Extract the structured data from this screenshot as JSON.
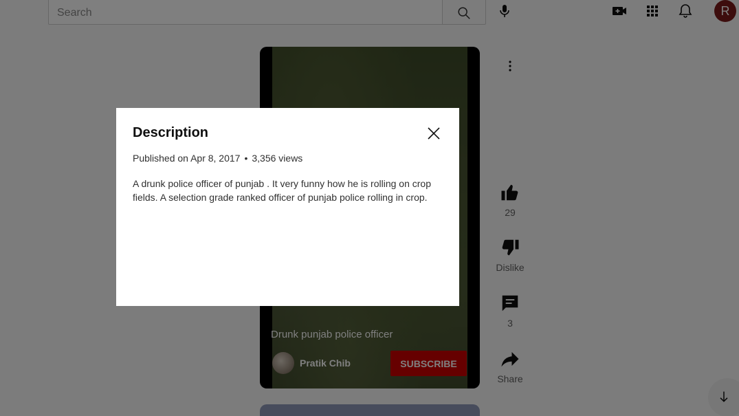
{
  "header": {
    "search_placeholder": "Search",
    "avatar_letter": "R"
  },
  "video": {
    "title": "Drunk punjab police officer",
    "channel": "Pratik Chib",
    "subscribe_label": "SUBSCRIBE"
  },
  "actions": {
    "like_count": "29",
    "dislike_label": "Dislike",
    "comments_count": "3",
    "share_label": "Share"
  },
  "dialog": {
    "title": "Description",
    "published": "Published on Apr 8, 2017",
    "separator": "•",
    "views": "3,356 views",
    "description": "A drunk police officer of punjab . It very funny how he is rolling on crop fields. A selection grade ranked officer of punjab police rolling in crop."
  },
  "icons": {
    "search": "search-icon",
    "mic": "mic-icon",
    "create": "video-add-icon",
    "apps": "apps-grid-icon",
    "notifications": "bell-icon",
    "more": "more-vertical-icon",
    "like": "thumb-up-icon",
    "dislike": "thumb-down-icon",
    "comments": "comment-icon",
    "share": "share-icon",
    "close": "close-icon",
    "scroll": "arrow-down-icon"
  },
  "colors": {
    "subscribe": "#cc0000",
    "avatar": "#7a1b1b"
  }
}
